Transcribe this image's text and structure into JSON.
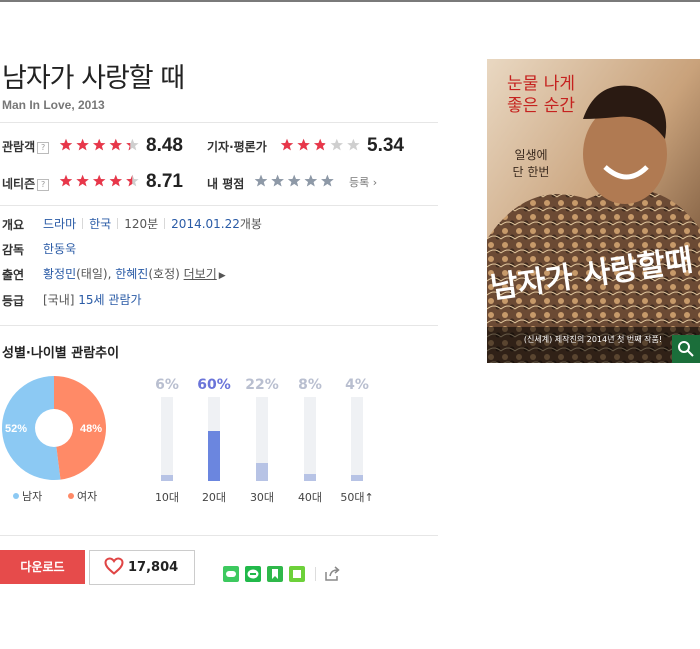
{
  "movie": {
    "title": "남자가 사랑할 때",
    "subtitle": "Man In Love, 2013"
  },
  "ratings": {
    "audience": {
      "label": "관람객",
      "help": "?",
      "score": "8.48",
      "stars": 4.24
    },
    "critic": {
      "label": "기자·평론가",
      "score": "5.34",
      "stars": 2.67
    },
    "netizen": {
      "label": "네티즌",
      "help": "?",
      "score": "8.71",
      "stars": 4.36
    },
    "my": {
      "label": "내 평점",
      "action": "등록 ›",
      "stars": 0
    }
  },
  "info": {
    "overview_label": "개요",
    "genre": "드라마",
    "country": "한국",
    "runtime": "120분",
    "release": "2014.01.22",
    "release_suffix": "개봉",
    "director_label": "감독",
    "director": "한동욱",
    "cast_label": "출연",
    "cast_1": "황정민",
    "cast_1_role": "(태일),",
    "cast_2": "한혜진",
    "cast_2_role": "(호정)",
    "more": "더보기",
    "rating_label": "등급",
    "rating_region": "[국내]",
    "rating_value": "15세 관람가"
  },
  "trend": {
    "title": "성별·나이별 관람추이",
    "gender": [
      {
        "name": "남자",
        "percent": 52,
        "label": "52%",
        "color": "#8cc9f3"
      },
      {
        "name": "여자",
        "percent": 48,
        "label": "48%",
        "color": "#ff8a67"
      }
    ],
    "ages": [
      {
        "age": "10대",
        "percent": 6,
        "label": "6%"
      },
      {
        "age": "20대",
        "percent": 60,
        "label": "60%",
        "highlight": true
      },
      {
        "age": "30대",
        "percent": 22,
        "label": "22%"
      },
      {
        "age": "40대",
        "percent": 8,
        "label": "8%"
      },
      {
        "age": "50대",
        "percent": 4,
        "label": "4%",
        "suffix": "↑"
      }
    ]
  },
  "actions": {
    "download": "다운로드",
    "likes": "17,804",
    "share_icons": [
      "band-icon",
      "line-icon",
      "bookmark-icon",
      "memo-icon",
      "share-icon"
    ]
  },
  "poster": {
    "tagline_1": "눈물 나게",
    "tagline_2": "좋은 순간",
    "tagline_3": "일생에",
    "tagline_4": "단 한번",
    "title_art": "남자가 사랑할때",
    "footer": "(신세계) 제작진의 2014년 첫 번째 작품!"
  }
}
